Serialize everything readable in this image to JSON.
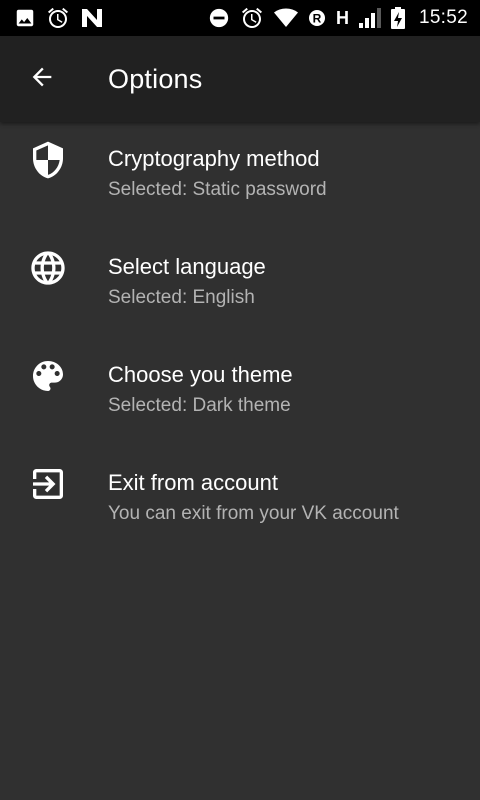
{
  "status_bar": {
    "time": "15:52",
    "network_letter": "H",
    "left_icons": [
      "image-icon",
      "alarm-icon",
      "n-logo-icon"
    ],
    "right_icons": [
      "do-not-disturb-icon",
      "alarm-icon",
      "wifi-icon",
      "roaming-icon",
      "signal-icon",
      "battery-charging-icon"
    ]
  },
  "app_bar": {
    "title": "Options",
    "back_icon": "arrow-back-icon"
  },
  "options": [
    {
      "icon": "shield-icon",
      "title": "Cryptography method",
      "subtitle": "Selected: Static password"
    },
    {
      "icon": "globe-icon",
      "title": "Select language",
      "subtitle": "Selected: English"
    },
    {
      "icon": "palette-icon",
      "title": "Choose you theme",
      "subtitle": "Selected: Dark theme"
    },
    {
      "icon": "exit-icon",
      "title": "Exit from account",
      "subtitle": "You can exit from your VK account"
    }
  ],
  "colors": {
    "background": "#303030",
    "app_bar": "#212121",
    "status_bar": "#000000",
    "primary_text": "#ffffff",
    "secondary_text": "#b3b3b3"
  }
}
